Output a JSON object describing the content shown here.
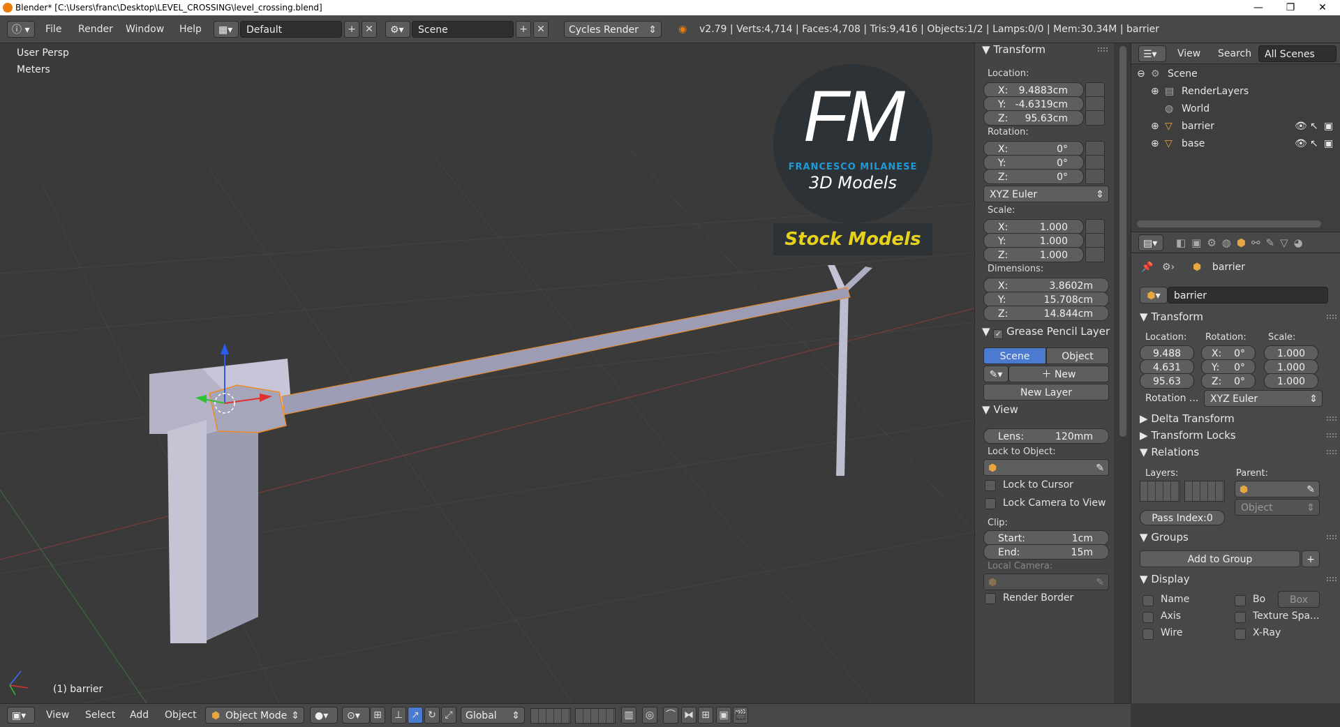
{
  "window": {
    "title": "Blender* [C:\\Users\\franc\\Desktop\\LEVEL_CROSSING\\level_crossing.blend]",
    "minimize": "—",
    "maximize": "❐",
    "close": "✕"
  },
  "menu": {
    "file": "File",
    "render": "Render",
    "window": "Window",
    "help": "Help"
  },
  "screen_layout": "Default",
  "scene_name": "Scene",
  "render_engine": "Cycles Render",
  "stats": "v2.79 | Verts:4,714 | Faces:4,708 | Tris:9,416 | Objects:1/2 | Lamps:0/0 | Mem:30.34M | barrier",
  "viewport": {
    "view_name": "User Persp",
    "units": "Meters",
    "object_label": "(1) barrier",
    "logo": {
      "letters": "FM",
      "name": "FRANCESCO MILANESE",
      "subtitle": "3D Models",
      "banner": "Stock Models"
    }
  },
  "npanel": {
    "transform_header": "Transform",
    "location_label": "Location:",
    "location": {
      "x": "9.4883cm",
      "y": "-4.6319cm",
      "z": "95.63cm"
    },
    "rotation_label": "Rotation:",
    "rotation": {
      "x": "0°",
      "y": "0°",
      "z": "0°"
    },
    "rotation_mode": "XYZ Euler",
    "scale_label": "Scale:",
    "scale": {
      "x": "1.000",
      "y": "1.000",
      "z": "1.000"
    },
    "dimensions_label": "Dimensions:",
    "dimensions": {
      "x": "3.8602m",
      "y": "15.708cm",
      "z": "14.844cm"
    },
    "axis": {
      "x": "X:",
      "y": "Y:",
      "z": "Z:"
    },
    "grease_header": "Grease Pencil Layer",
    "gp_scene": "Scene",
    "gp_object": "Object",
    "gp_new": "New",
    "gp_new_layer": "New Layer",
    "view_header": "View",
    "lens_label": "Lens:",
    "lens_value": "120mm",
    "lock_to_object": "Lock to Object:",
    "lock_to_cursor": "Lock to Cursor",
    "lock_camera": "Lock Camera to View",
    "clip_label": "Clip:",
    "clip_start_label": "Start:",
    "clip_start": "1cm",
    "clip_end_label": "End:",
    "clip_end": "15m",
    "local_camera": "Local Camera:",
    "render_border": "Render Border"
  },
  "outliner": {
    "view": "View",
    "search": "Search",
    "all_scenes": "All Scenes",
    "items": [
      {
        "label": "Scene"
      },
      {
        "label": "RenderLayers"
      },
      {
        "label": "World"
      },
      {
        "label": "barrier"
      },
      {
        "label": "base"
      }
    ]
  },
  "properties": {
    "breadcrumb": "barrier",
    "object_name": "barrier",
    "transform_header": "Transform",
    "location_label": "Location:",
    "rotation_label": "Rotation:",
    "scale_label": "Scale:",
    "loc": [
      "9.488",
      "4.631",
      "95.63"
    ],
    "rot": [
      "0°",
      "0°",
      "0°"
    ],
    "rot_axes": [
      "X:",
      "Y:",
      "Z:"
    ],
    "scl": [
      "1.000",
      "1.000",
      "1.000"
    ],
    "rotation_mode_label": "Rotation ...",
    "rotation_mode": "XYZ Euler",
    "delta_transform": "Delta Transform",
    "transform_locks": "Transform Locks",
    "relations": "Relations",
    "layers_label": "Layers:",
    "parent_label": "Parent:",
    "parent_type": "Object",
    "pass_index": "Pass Index:0",
    "groups": "Groups",
    "add_to_group": "Add to Group",
    "display": "Display",
    "name": "Name",
    "bo": "Bo",
    "box": "Box",
    "axis": "Axis",
    "texture_space": "Texture Spa...",
    "wire": "Wire",
    "xray": "X-Ray"
  },
  "bottombar": {
    "view": "View",
    "select": "Select",
    "add": "Add",
    "object": "Object",
    "mode": "Object Mode",
    "orientation": "Global"
  },
  "colors": {
    "accent_blue": "#4a7bd0",
    "logo_blue": "#1e9ad6",
    "logo_yellow": "#e8d11a",
    "selection_orange": "#f08a24"
  }
}
